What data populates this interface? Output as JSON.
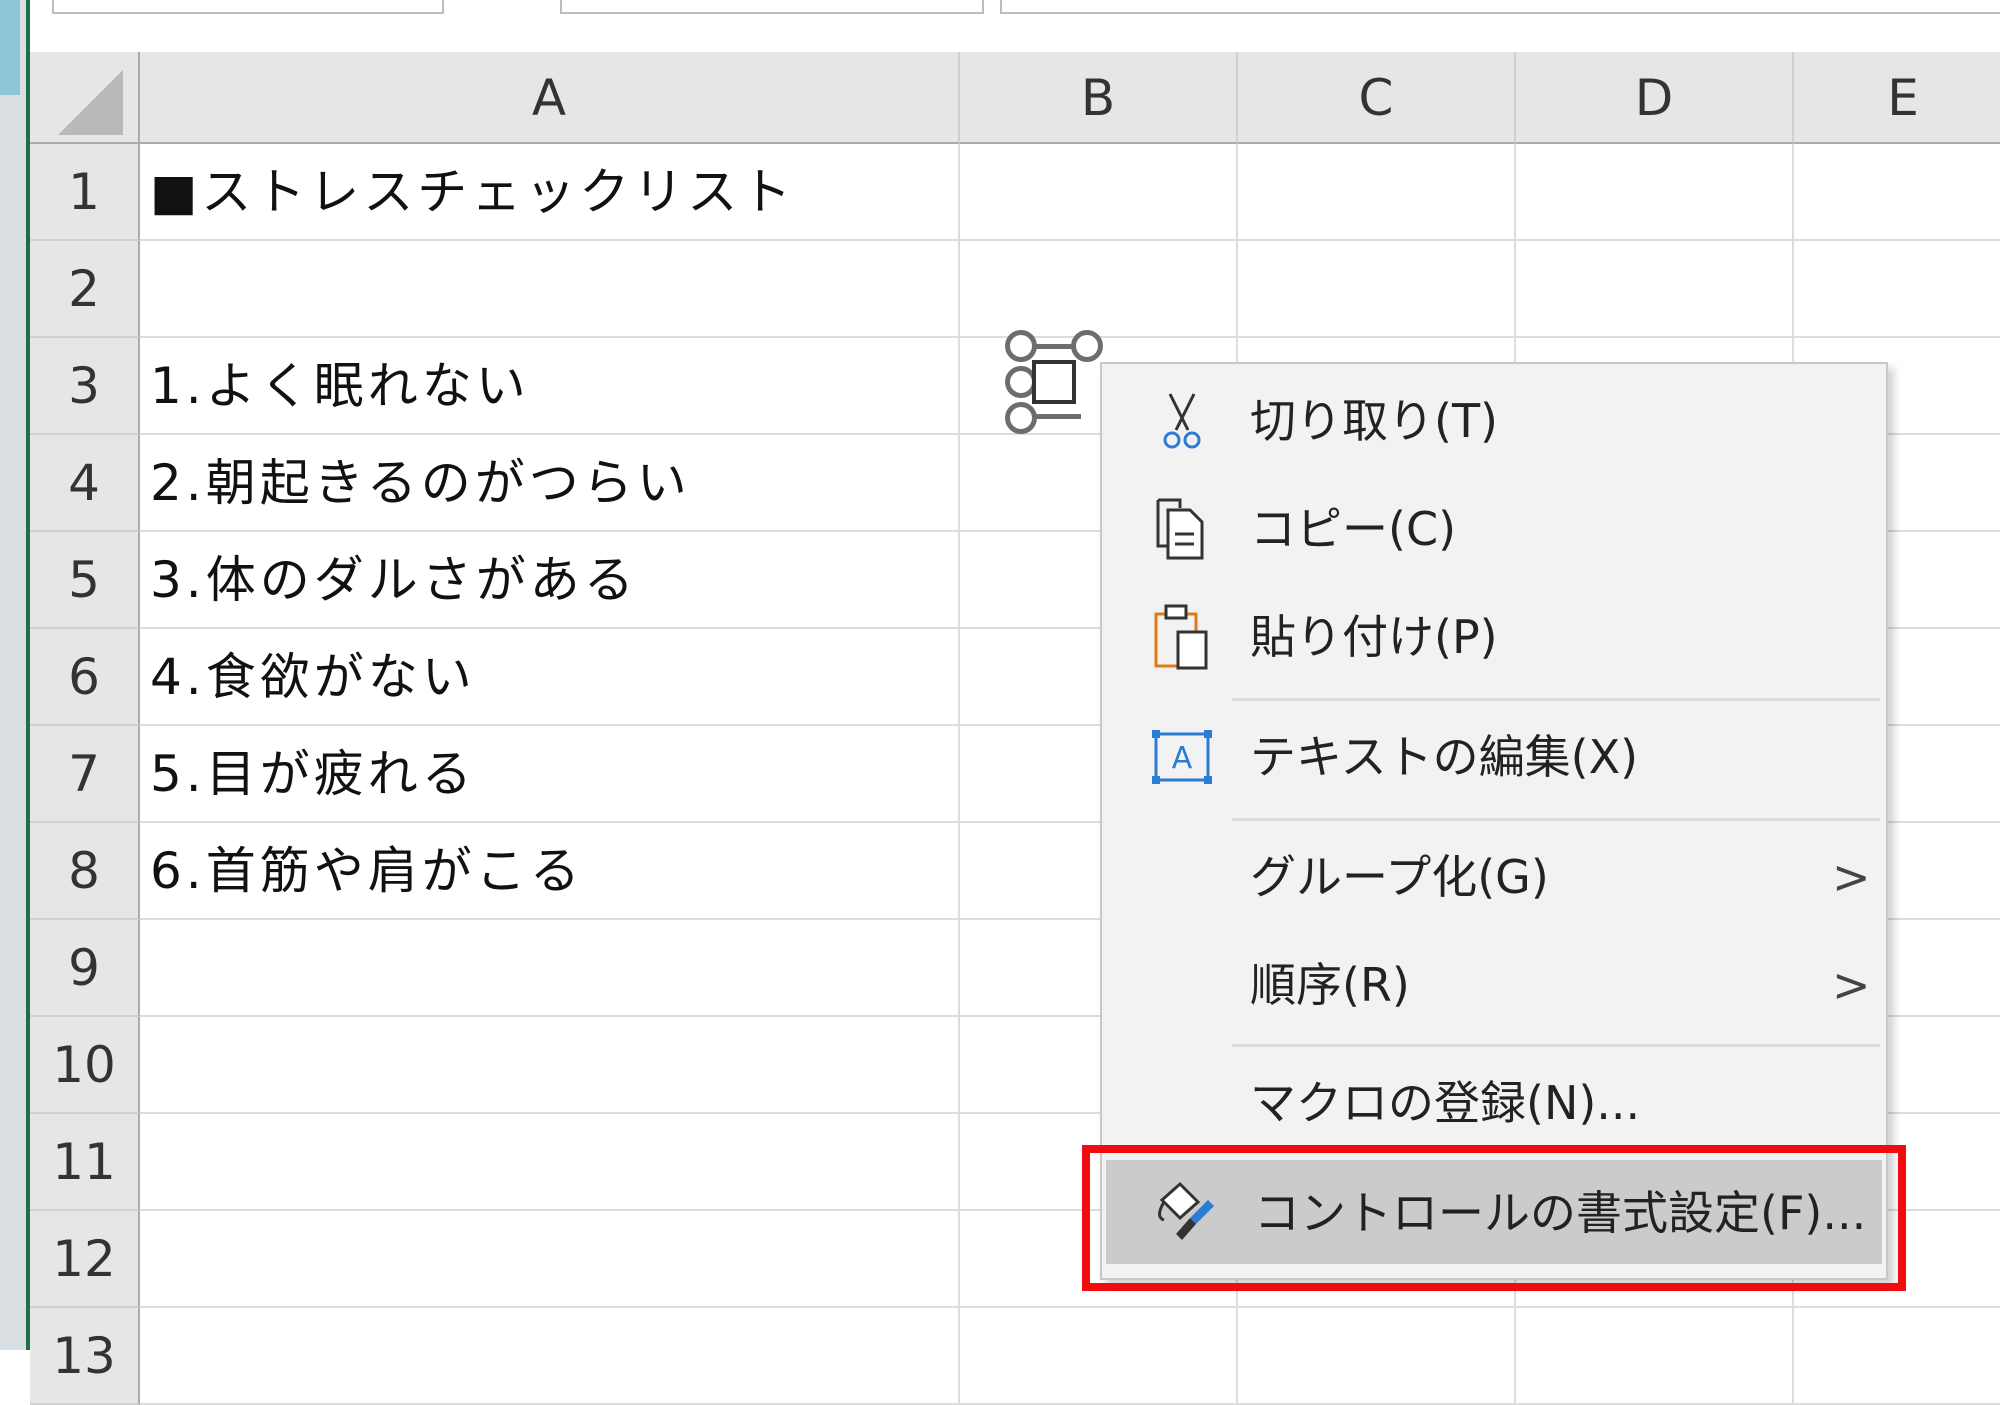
{
  "columns": [
    "A",
    "B",
    "C",
    "D",
    "E"
  ],
  "rows": [
    {
      "num": "1",
      "a": "■ストレスチェックリスト"
    },
    {
      "num": "2",
      "a": ""
    },
    {
      "num": "3",
      "a": "1.よく眠れない"
    },
    {
      "num": "4",
      "a": "2.朝起きるのがつらい"
    },
    {
      "num": "5",
      "a": "3.体のダルさがある"
    },
    {
      "num": "6",
      "a": "4.食欲がない"
    },
    {
      "num": "7",
      "a": "5.目が疲れる"
    },
    {
      "num": "8",
      "a": "6.首筋や肩がこる"
    },
    {
      "num": "9",
      "a": ""
    },
    {
      "num": "10",
      "a": ""
    },
    {
      "num": "11",
      "a": ""
    },
    {
      "num": "12",
      "a": ""
    },
    {
      "num": "13",
      "a": ""
    }
  ],
  "context_menu": {
    "cut": {
      "label": "切り取り(T)",
      "icon": "scissors-icon"
    },
    "copy": {
      "label": "コピー(C)",
      "icon": "copy-icon"
    },
    "paste": {
      "label": "貼り付け(P)",
      "icon": "paste-icon"
    },
    "edit_text": {
      "label": "テキストの編集(X)",
      "icon": "edit-text-icon"
    },
    "group": {
      "label": "グループ化(G)",
      "arrow": ">"
    },
    "order": {
      "label": "順序(R)",
      "arrow": ">"
    },
    "assign_macro": {
      "label": "マクロの登録(N)..."
    },
    "format_control": {
      "label": "コントロールの書式設定(F)...",
      "icon": "format-brush-icon"
    }
  },
  "colors": {
    "highlight_border": "#ef0b10",
    "excel_green": "#1e7145",
    "icon_blue": "#2b7cd3",
    "icon_orange": "#e07b1a"
  }
}
